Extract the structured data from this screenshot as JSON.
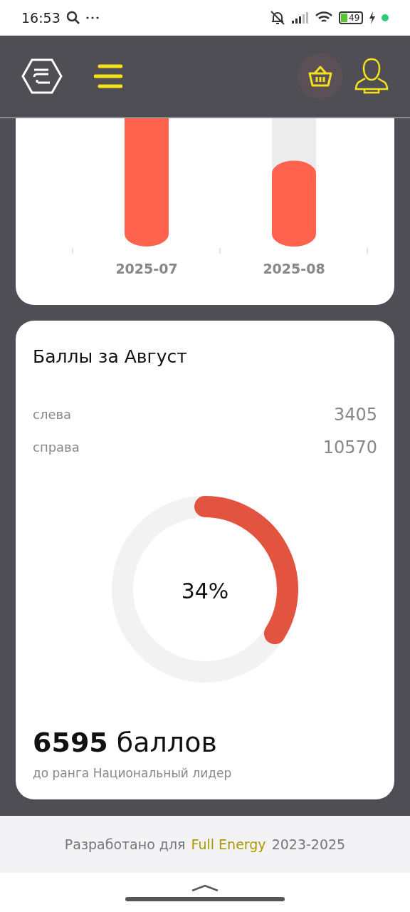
{
  "status_bar": {
    "time": "16:53",
    "battery": "49"
  },
  "bars": [
    {
      "category": "2025-07"
    },
    {
      "category": "2025-08"
    }
  ],
  "points_card": {
    "title": "Баллы за Август",
    "rows": [
      {
        "label": "слева",
        "value": "3405"
      },
      {
        "label": "справа",
        "value": "10570"
      }
    ],
    "progress": {
      "reading": "34%"
    },
    "remaining": {
      "number": "6595",
      "unit": "баллов"
    },
    "caption": "до ранга Национальный лидер"
  },
  "footer": {
    "prefix": "Разработано для",
    "brand": "Full Energy",
    "years": "2023-2025"
  }
}
